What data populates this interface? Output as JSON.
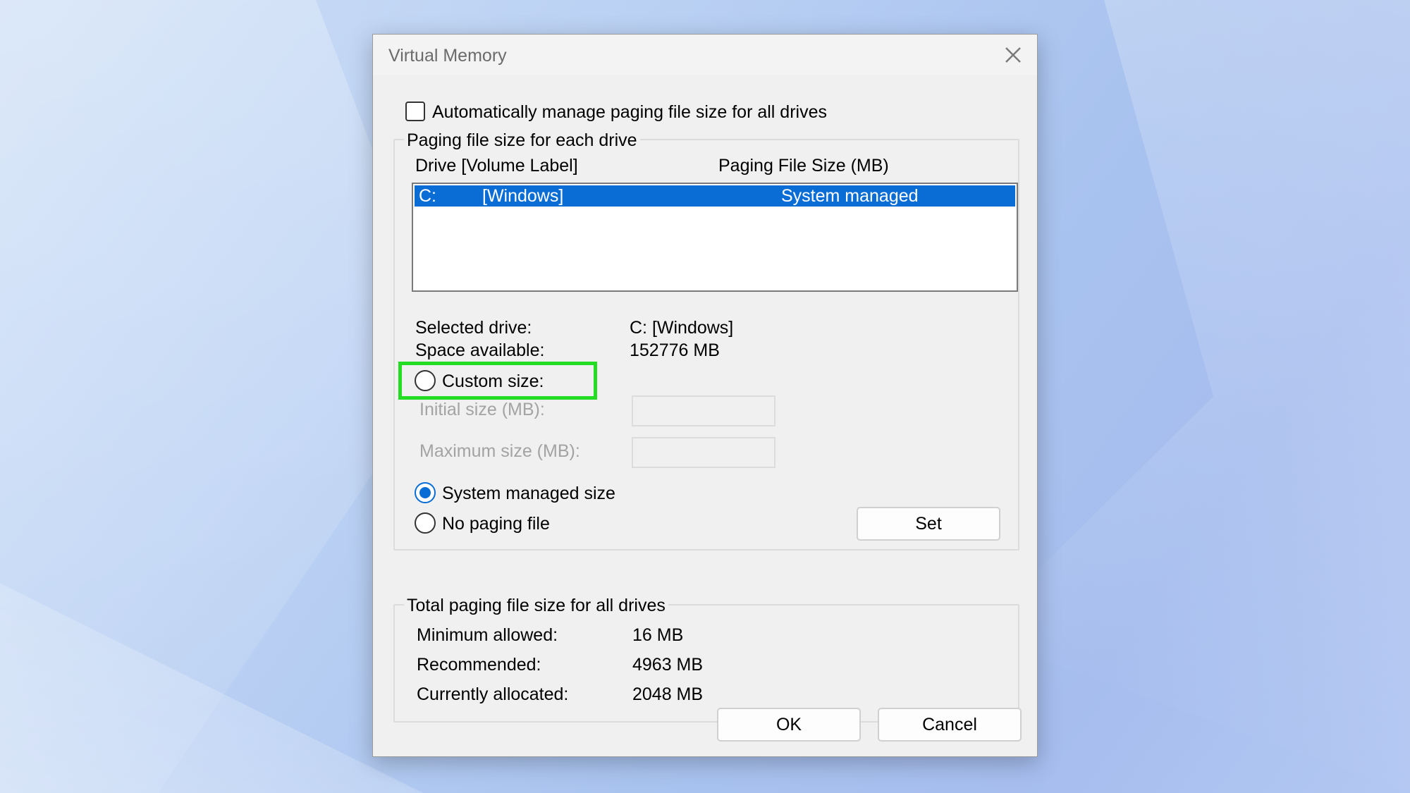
{
  "dialog": {
    "title": "Virtual Memory",
    "auto_manage_label": "Automatically manage paging file size for all drives",
    "auto_manage_checked": false
  },
  "paging_group": {
    "legend": "Paging file size for each drive",
    "col_drive": "Drive  [Volume Label]",
    "col_size": "Paging File Size (MB)",
    "rows": [
      {
        "drive": "C:",
        "label": "[Windows]",
        "size": "System managed"
      }
    ],
    "selected_drive_label": "Selected drive:",
    "selected_drive_value": "C:  [Windows]",
    "space_available_label": "Space available:",
    "space_available_value": "152776 MB",
    "custom_size_label": "Custom size:",
    "initial_size_label": "Initial size (MB):",
    "initial_size_value": "",
    "maximum_size_label": "Maximum size (MB):",
    "maximum_size_value": "",
    "system_managed_label": "System managed size",
    "no_paging_label": "No paging file",
    "selected_option": "system_managed",
    "set_label": "Set"
  },
  "total_group": {
    "legend": "Total paging file size for all drives",
    "minimum_label": "Minimum allowed:",
    "minimum_value": "16 MB",
    "recommended_label": "Recommended:",
    "recommended_value": "4963 MB",
    "allocated_label": "Currently allocated:",
    "allocated_value": "2048 MB"
  },
  "buttons": {
    "ok": "OK",
    "cancel": "Cancel"
  },
  "colors": {
    "selection": "#0a6cd5",
    "highlight_box": "#22dd22"
  }
}
